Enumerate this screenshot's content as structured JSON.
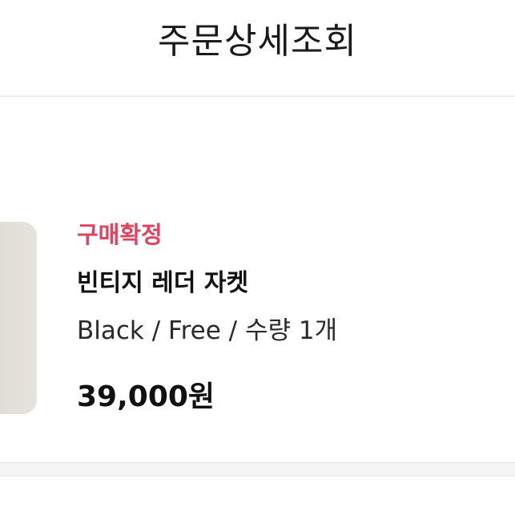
{
  "header": {
    "title": "주문상세조회"
  },
  "order": {
    "status": "구매확정",
    "product_name": "빈티지 레더 자켓",
    "option": "Black / Free / 수량 1개",
    "price": "39,000원"
  },
  "colors": {
    "status": "#e0435f",
    "text": "#111111",
    "divider": "#f5f5f5"
  }
}
